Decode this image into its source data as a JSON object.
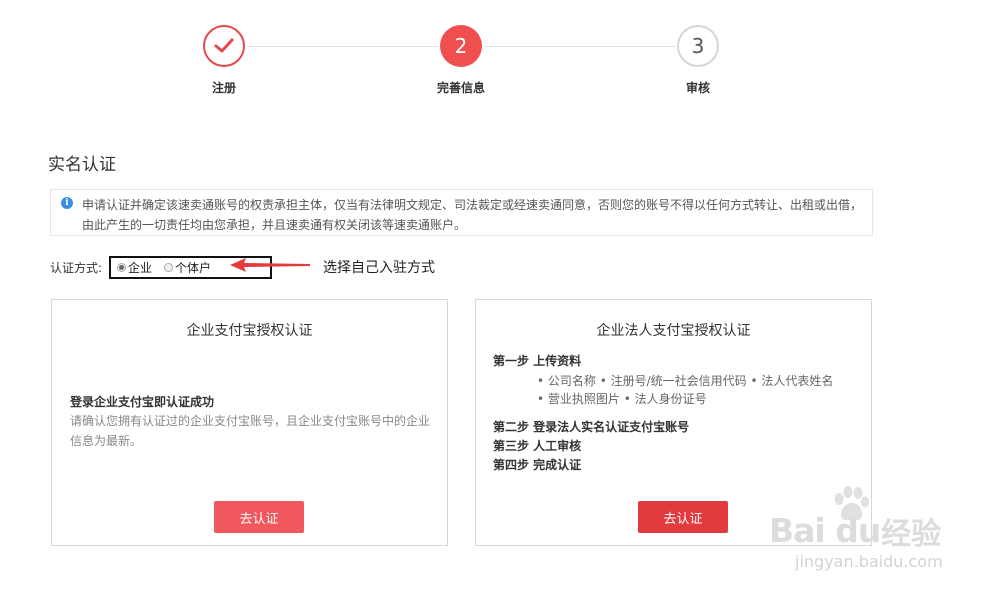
{
  "stepper": {
    "steps": [
      {
        "label": "注册",
        "state": "done",
        "icon": "checkmark-icon"
      },
      {
        "label": "完善信息",
        "state": "active",
        "number": "2"
      },
      {
        "label": "审核",
        "state": "todo",
        "number": "3"
      }
    ]
  },
  "section_title": "实名认证",
  "notice": {
    "icon": "info-icon",
    "text": "申请认证并确定该速卖通账号的权责承担主体，仅当有法律明文规定、司法裁定或经速卖通同意，否则您的账号不得以任何方式转让、出租或出借，由此产生的一切责任均由您承担，并且速卖通有权关闭该等速卖通账户。"
  },
  "method": {
    "label": "认证方式:",
    "options": [
      {
        "label": "企业",
        "selected": true
      },
      {
        "label": "个体户",
        "selected": false
      }
    ]
  },
  "annotation": "选择自己入驻方式",
  "card_enterprise": {
    "title": "企业支付宝授权认证",
    "heading": "登录企业支付宝即认证成功",
    "description": "请确认您拥有认证过的企业支付宝账号，且企业支付宝账号中的企业信息为最新。",
    "button": "去认证"
  },
  "card_legal": {
    "title": "企业法人支付宝授权认证",
    "step1": "第一步 上传资料",
    "step1_items": [
      "• 公司名称 • 注册号/统一社会信用代码 • 法人代表姓名",
      "• 营业执照图片 • 法人身份证号"
    ],
    "step2": "第二步 登录法人实名认证支付宝账号",
    "step3": "第三步 人工审核",
    "step4": "第四步 完成认证",
    "button": "去认证"
  },
  "watermark": {
    "brand": "Bai du",
    "brand_cn": "经验",
    "url": "jingyan.baidu.com"
  },
  "colors": {
    "accent": "#ef4f4f",
    "button_light": "#f0585d",
    "button_dark": "#e33a3f",
    "info": "#3a8ee6"
  }
}
